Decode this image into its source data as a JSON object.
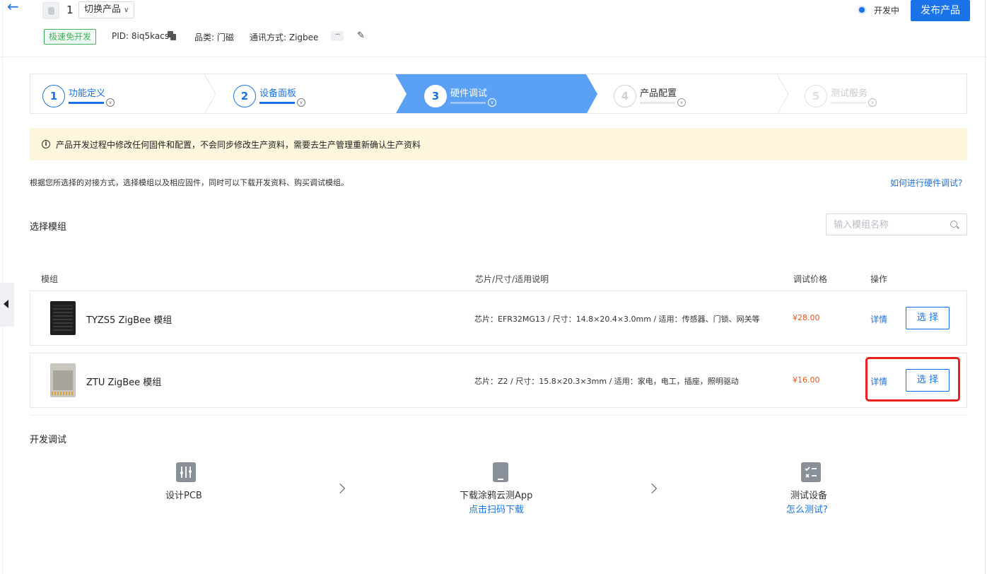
{
  "header": {
    "product_id_num": "1",
    "switch_label": "切换产品",
    "status_text": "开发中",
    "publish_label": "发布产品",
    "badge": "极速免开发",
    "pid": "PID: 8iq5kacs",
    "category": "品类: 门磁",
    "protocol": "通讯方式: Zigbee",
    "more": "···"
  },
  "steps": [
    {
      "num": "1",
      "label": "功能定义",
      "state": "done"
    },
    {
      "num": "2",
      "label": "设备面板",
      "state": "done"
    },
    {
      "num": "3",
      "label": "硬件调试",
      "state": "active"
    },
    {
      "num": "4",
      "label": "产品配置",
      "state": "todo"
    },
    {
      "num": "5",
      "label": "测试服务",
      "state": "faded"
    }
  ],
  "notice": {
    "icon": "info-icon",
    "text": "产品开发过程中修改任何固件和配置，不会同步修改生产资料，需要去生产管理重新确认生产资料"
  },
  "description": "根据您所选择的对接方式，选择模组以及相应固件，同时可以下载开发资料、购买调试模组。",
  "help_link": "如何进行硬件调试?",
  "module_section": {
    "title": "选择模组",
    "search_placeholder": "输入模组名称",
    "columns": {
      "module": "模组",
      "chip": "芯片/尺寸/适用说明",
      "price": "调试价格",
      "action": "操作"
    },
    "rows": [
      {
        "name": "TYZS5 ZigBee 模组",
        "chip": "芯片：EFR32MG13 / 尺寸：14.8×20.4×3.0mm / 适用：传感器、门锁、网关等",
        "price": "¥28.00",
        "detail": "详情",
        "select": "选 择"
      },
      {
        "name": "ZTU ZigBee 模组",
        "chip": "芯片：Z2 / 尺寸：15.8×20.3×3mm / 适用：家电，电工，插座，照明驱动",
        "price": "¥16.00",
        "detail": "详情",
        "select": "选 择"
      }
    ]
  },
  "dev_section": {
    "title": "开发调试",
    "steps": [
      {
        "icon": "pcb-icon",
        "label": "设计PCB",
        "link": ""
      },
      {
        "icon": "phone-icon",
        "label": "下载涂鸦云测App",
        "link": "点击扫码下载"
      },
      {
        "icon": "checklist-icon",
        "label": "测试设备",
        "link": "怎么测试?"
      }
    ]
  },
  "colors": {
    "accent": "#1a73e8",
    "active_step": "#5aa0f4",
    "price": "#e25a1c",
    "highlight": "#e8211e",
    "notice_bg": "#fdf6dd"
  }
}
